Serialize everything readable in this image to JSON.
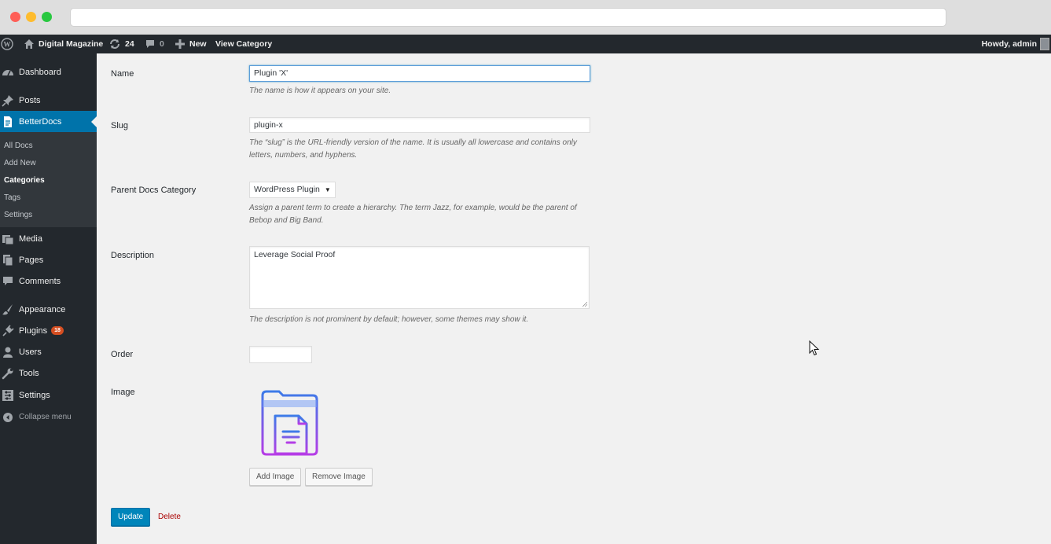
{
  "adminbar": {
    "site_name": "Digital Magazine",
    "updates_count": "24",
    "comments_count": "0",
    "new_label": "New",
    "view_label": "View Category",
    "howdy": "Howdy, admin"
  },
  "sidebar": {
    "dashboard": "Dashboard",
    "posts": "Posts",
    "betterdocs": "BetterDocs",
    "sub": {
      "all_docs": "All Docs",
      "add_new": "Add New",
      "categories": "Categories",
      "tags": "Tags",
      "settings": "Settings"
    },
    "media": "Media",
    "pages": "Pages",
    "comments": "Comments",
    "appearance": "Appearance",
    "plugins": "Plugins",
    "plugins_badge": "18",
    "users": "Users",
    "tools": "Tools",
    "settings": "Settings",
    "collapse": "Collapse menu"
  },
  "form": {
    "name_label": "Name",
    "name_value": "Plugin 'X'",
    "name_desc": "The name is how it appears on your site.",
    "slug_label": "Slug",
    "slug_value": "plugin-x",
    "slug_desc_1": "The “slug” is the URL-friendly version of the name. It is usually all lowercase and contains only",
    "slug_desc_2": "letters, numbers, and hyphens.",
    "parent_label": "Parent Docs Category",
    "parent_value": "WordPress Plugin",
    "parent_desc_1": "Assign a parent term to create a hierarchy. The term Jazz, for example, would be the parent of",
    "parent_desc_2": "Bebop and Big Band.",
    "description_label": "Description",
    "description_value": "Leverage Social Proof",
    "description_desc": "The description is not prominent by default; however, some themes may show it.",
    "order_label": "Order",
    "order_value": "",
    "image_label": "Image",
    "add_image": "Add Image",
    "remove_image": "Remove Image",
    "update": "Update",
    "delete": "Delete"
  },
  "colors": {
    "admin_bg": "#23282d",
    "accent": "#0073aa",
    "content_bg": "#f1f1f1",
    "icon_gradient_start": "#3d7be8",
    "icon_gradient_end": "#b63de6"
  }
}
